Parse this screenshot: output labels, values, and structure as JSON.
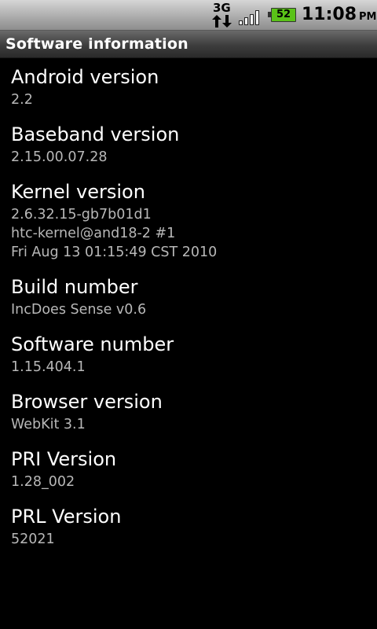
{
  "status_bar": {
    "network_type": "3G",
    "battery_level": "52",
    "time": "11:08",
    "ampm": "PM",
    "signal_icon": "signal-bars-icon",
    "data_icon": "data-arrows-icon",
    "battery_icon": "battery-icon",
    "battery_color": "#5ac218"
  },
  "header": {
    "title": "Software information"
  },
  "items": [
    {
      "label": "Android version",
      "value_lines": [
        "2.2"
      ]
    },
    {
      "label": "Baseband version",
      "value_lines": [
        "2.15.00.07.28"
      ]
    },
    {
      "label": "Kernel version",
      "value_lines": [
        "2.6.32.15-gb7b01d1",
        "htc-kernel@and18-2 #1",
        "Fri Aug 13 01:15:49 CST 2010"
      ]
    },
    {
      "label": "Build number",
      "value_lines": [
        "IncDoes Sense v0.6"
      ]
    },
    {
      "label": "Software number",
      "value_lines": [
        "1.15.404.1"
      ]
    },
    {
      "label": "Browser version",
      "value_lines": [
        "WebKit 3.1"
      ]
    },
    {
      "label": "PRI Version",
      "value_lines": [
        "1.28_002"
      ]
    },
    {
      "label": "PRL Version",
      "value_lines": [
        "52021"
      ]
    }
  ]
}
